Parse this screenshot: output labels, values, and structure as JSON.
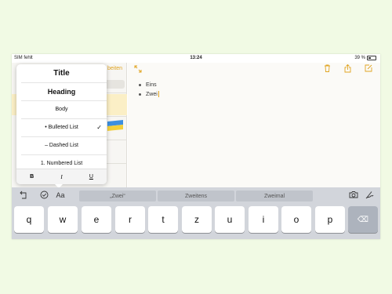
{
  "status": {
    "carrier": "SIM fehlt",
    "time": "13:24",
    "battery": "39 %"
  },
  "list_pane": {
    "edit_label": "beiten"
  },
  "note": {
    "lines": [
      "Eins",
      "Zwei"
    ]
  },
  "format_menu": {
    "title": "Title",
    "heading": "Heading",
    "body": "Body",
    "bulleted_list": "• Bulleted List",
    "dashed_list": "– Dashed List",
    "numbered_list": "1. Numbered List",
    "checked": "✓",
    "bold": "B",
    "italic": "I",
    "underline": "U"
  },
  "keyboard": {
    "format_label": "Aa",
    "suggestions": [
      "„Zwei“",
      "Zweitens",
      "Zweimal"
    ],
    "keys": [
      "q",
      "w",
      "e",
      "r",
      "t",
      "z",
      "u",
      "i",
      "o",
      "p"
    ],
    "backspace": "⌫"
  },
  "icons": {
    "expand": "expand-icon",
    "trash": "trash-icon",
    "share": "share-icon",
    "compose": "compose-icon",
    "undo": "undo-icon",
    "checklist": "checklist-icon",
    "camera": "camera-icon",
    "pen": "pen-icon"
  },
  "colors": {
    "accent": "#e0a421",
    "page_background": "#f1fae4",
    "keyboard": "#d2d5db"
  }
}
